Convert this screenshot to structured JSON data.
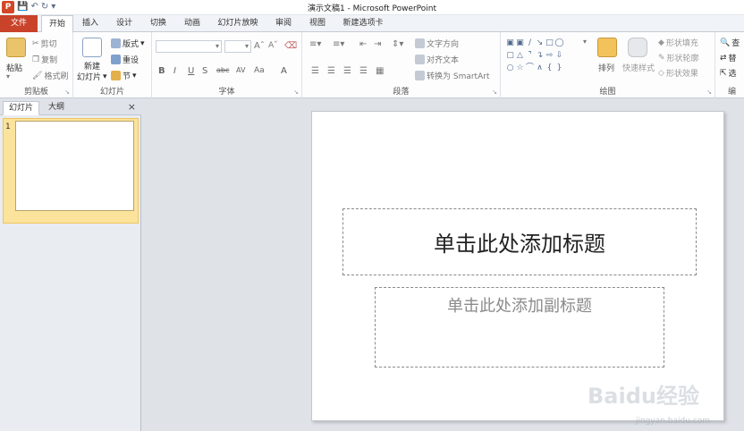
{
  "window": {
    "title": "演示文稿1 - Microsoft PowerPoint",
    "app_icon_letter": "P"
  },
  "tabs": [
    {
      "label": "文件"
    },
    {
      "label": "开始"
    },
    {
      "label": "插入"
    },
    {
      "label": "设计"
    },
    {
      "label": "切换"
    },
    {
      "label": "动画"
    },
    {
      "label": "幻灯片放映"
    },
    {
      "label": "审阅"
    },
    {
      "label": "视图"
    },
    {
      "label": "新建选项卡"
    }
  ],
  "ribbon": {
    "clipboard": {
      "paste": "粘贴",
      "cut": "剪切",
      "copy": "复制",
      "format_painter": "格式刷",
      "group_label": "剪贴板"
    },
    "slides": {
      "new_slide_line1": "新建",
      "new_slide_line2": "幻灯片",
      "layout": "版式",
      "reset": "重设",
      "section": "节",
      "group_label": "幻灯片"
    },
    "font": {
      "group_label": "字体"
    },
    "paragraph": {
      "text_direction": "文字方向",
      "align_text": "对齐文本",
      "convert_smartart": "转换为 SmartArt",
      "group_label": "段落"
    },
    "drawing": {
      "arrange": "排列",
      "quick_styles": "快速样式",
      "shape_fill": "形状填充",
      "shape_outline": "形状轮廓",
      "shape_effects": "形状效果",
      "group_label": "绘图"
    },
    "editing": {
      "find": "查",
      "replace": "替",
      "select": "选",
      "group_label": "编"
    }
  },
  "pane": {
    "tab_slides": "幻灯片",
    "tab_outline": "大纲",
    "close": "×",
    "slide_number": "1"
  },
  "slide": {
    "title_placeholder": "单击此处添加标题",
    "subtitle_placeholder": "单击此处添加副标题"
  },
  "watermark": {
    "brand": "Baidu经验",
    "url": "jingyan.baidu.com"
  },
  "colors": {
    "file_tab": "#c9432b",
    "selected_slide": "#fbe39b"
  }
}
